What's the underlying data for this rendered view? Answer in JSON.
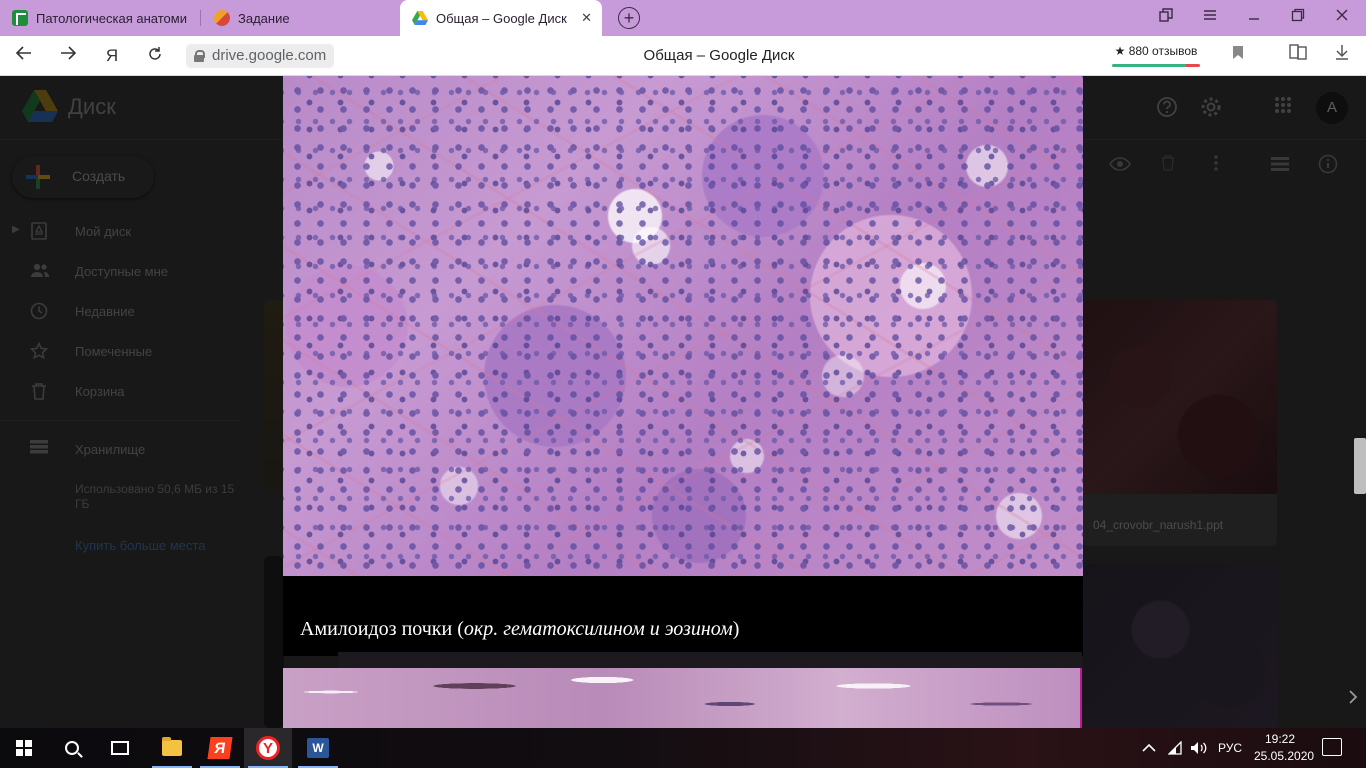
{
  "browser": {
    "tabs": [
      {
        "label": "Патологическая анатоми",
        "active": false
      },
      {
        "label": "Задание",
        "active": false
      },
      {
        "label": "Общая – Google Диск",
        "active": true
      }
    ],
    "close_glyph": "✕",
    "new_tab_glyph": "+",
    "url": "drive.google.com",
    "page_title": "Общая – Google Диск",
    "reviews": "★ 880 отзывов"
  },
  "drive": {
    "app_name": "Диск",
    "avatar_letter": "A",
    "create_label": "Создать",
    "sidebar": {
      "items": [
        {
          "label": "Мой диск",
          "icon": "my-drive-icon"
        },
        {
          "label": "Доступные мне",
          "icon": "shared-icon"
        },
        {
          "label": "Недавние",
          "icon": "clock-icon"
        },
        {
          "label": "Помеченные",
          "icon": "star-icon"
        },
        {
          "label": "Корзина",
          "icon": "trash-icon"
        }
      ],
      "storage_label": "Хранилище",
      "usage": "Использовано 50,6 МБ из 15 ГБ",
      "buy_more": "Купить больше места"
    },
    "files": [
      {
        "name": "04_crovobr_narush1.ppt"
      }
    ]
  },
  "viewer": {
    "caption_main": "Амилоидоз почки (",
    "caption_italic": "окр. гематоксилином и эозином",
    "caption_end": ")"
  },
  "taskbar": {
    "language": "РУС",
    "time": "19:22",
    "date": "25.05.2020"
  },
  "colors": {
    "tab_strip": "#c79bd9",
    "caption_band": "#000000",
    "slide_border": "#c4149a"
  }
}
